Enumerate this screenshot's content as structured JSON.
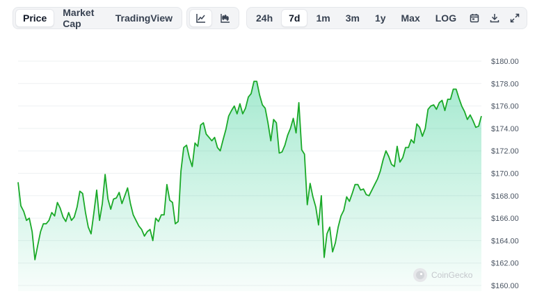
{
  "toolbar": {
    "type_tabs": [
      "Price",
      "Market Cap",
      "TradingView"
    ],
    "active_type": "Price",
    "view_icons": [
      "line-chart-icon",
      "candlestick-chart-icon"
    ],
    "ranges": [
      "24h",
      "7d",
      "1m",
      "3m",
      "1y",
      "Max",
      "LOG"
    ],
    "active_range": "7d",
    "tool_icons": [
      "calendar-icon",
      "download-icon",
      "expand-icon"
    ]
  },
  "watermark": {
    "text": "CoinGecko"
  },
  "colors": {
    "line": "#1aa928",
    "fill": "#16c784",
    "grid": "#eef0f2"
  },
  "chart_data": {
    "type": "area",
    "ylim": [
      159.5,
      181.0
    ],
    "yticks": [
      "$160.00",
      "$162.00",
      "$164.00",
      "$166.00",
      "$168.00",
      "$170.00",
      "$172.00",
      "$174.00",
      "$176.00",
      "$178.00",
      "$180.00"
    ],
    "ytick_values": [
      160,
      162,
      164,
      166,
      168,
      170,
      172,
      174,
      176,
      178,
      180
    ],
    "grid": true,
    "series": [
      {
        "values": [
          169.2,
          167.1,
          166.6,
          165.8,
          166.0,
          164.8,
          162.3,
          163.6,
          164.8,
          165.5,
          165.5,
          165.8,
          166.5,
          166.2,
          167.4,
          166.9,
          166.1,
          165.7,
          166.5,
          165.8,
          166.1,
          167.0,
          168.4,
          168.2,
          166.5,
          165.2,
          164.6,
          166.5,
          168.5,
          165.8,
          167.3,
          169.9,
          167.7,
          166.8,
          167.7,
          167.8,
          168.3,
          167.3,
          168.0,
          168.7,
          167.3,
          166.3,
          165.8,
          165.3,
          165.0,
          164.4,
          164.8,
          165.0,
          164.0,
          166.0,
          165.7,
          166.3,
          166.3,
          169.0,
          167.6,
          167.4,
          165.5,
          165.7,
          170.2,
          172.3,
          172.5,
          171.4,
          170.6,
          172.7,
          172.4,
          174.3,
          174.5,
          173.5,
          173.2,
          172.9,
          173.2,
          172.3,
          172.0,
          173.0,
          173.9,
          175.1,
          175.6,
          176.0,
          175.3,
          176.2,
          175.3,
          175.8,
          176.8,
          177.1,
          178.2,
          178.2,
          177.0,
          176.1,
          175.8,
          174.5,
          172.9,
          174.8,
          174.5,
          171.8,
          171.9,
          172.5,
          173.4,
          174.0,
          174.9,
          173.6,
          176.3,
          172.1,
          171.7,
          167.2,
          169.1,
          167.9,
          167.0,
          165.4,
          168.0,
          162.5,
          164.6,
          165.2,
          163.0,
          163.8,
          165.2,
          166.2,
          166.7,
          167.9,
          167.5,
          168.2,
          169.0,
          169.0,
          168.5,
          168.6,
          168.1,
          168.0,
          168.5,
          169.0,
          169.5,
          170.2,
          171.2,
          172.0,
          171.5,
          170.8,
          170.6,
          172.4,
          171.0,
          171.4,
          172.3,
          172.3,
          173.0,
          172.7,
          174.4,
          174.1,
          173.3,
          174.0,
          175.7,
          176.0,
          176.1,
          175.7,
          176.3,
          176.5,
          175.6,
          176.6,
          176.6,
          177.5,
          177.5,
          176.7,
          176.0,
          175.5,
          174.8,
          175.2,
          174.7,
          174.1,
          174.2,
          175.1
        ]
      }
    ]
  }
}
